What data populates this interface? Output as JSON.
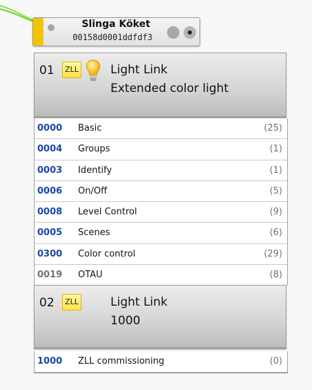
{
  "node": {
    "title": "Slinga Köket",
    "address": "00158d0001ddfdf3",
    "accent": "#f5c400"
  },
  "endpoints": [
    {
      "number": "01",
      "badge": "ZLL",
      "profile": "Light Link",
      "device": "Extended color light",
      "icon": "lightbulb-icon",
      "clusters": [
        {
          "id": "0000",
          "name": "Basic",
          "count": "(25)"
        },
        {
          "id": "0004",
          "name": "Groups",
          "count": "(1)"
        },
        {
          "id": "0003",
          "name": "Identify",
          "count": "(1)"
        },
        {
          "id": "0006",
          "name": "On/Off",
          "count": "(5)"
        },
        {
          "id": "0008",
          "name": "Level Control",
          "count": "(9)"
        },
        {
          "id": "0005",
          "name": "Scenes",
          "count": "(6)"
        },
        {
          "id": "0300",
          "name": "Color control",
          "count": "(29)"
        },
        {
          "id": "0019",
          "name": "OTAU",
          "count": "(8)"
        }
      ]
    },
    {
      "number": "02",
      "badge": "ZLL",
      "profile": "Light Link",
      "device": "1000",
      "clusters": [
        {
          "id": "1000",
          "name": "ZLL commissioning",
          "count": "(0)"
        }
      ]
    }
  ]
}
